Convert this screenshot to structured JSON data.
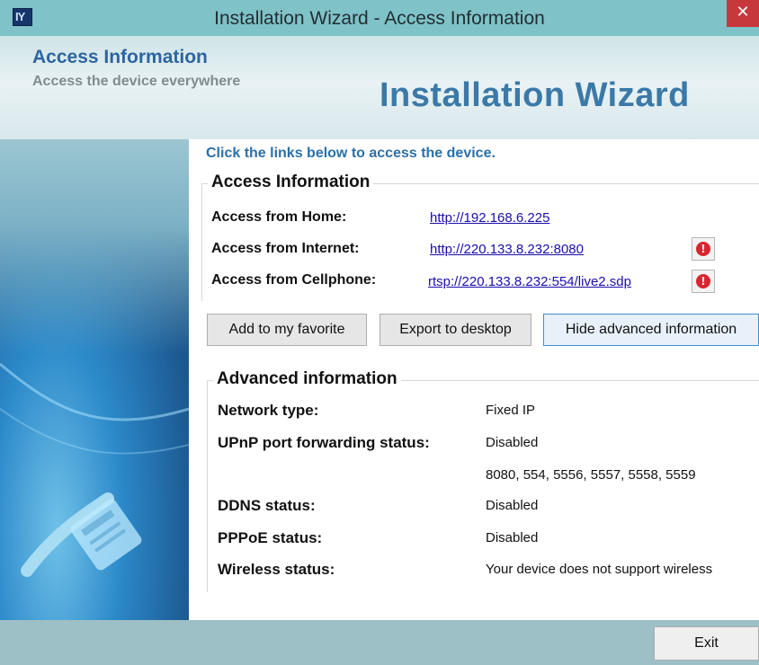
{
  "window": {
    "title": "Installation Wizard - Access Information",
    "close_glyph": "✕",
    "icon_text": "IY"
  },
  "banner": {
    "title": "Access Information",
    "subtitle": "Access the device everywhere",
    "wizard": "Installation Wizard"
  },
  "intro": "Click the links below to access the device.",
  "access": {
    "group_title": "Access Information",
    "rows": [
      {
        "label": "Access from Home:",
        "link": "http://192.168.6.225"
      },
      {
        "label": "Access from Internet:",
        "link": "http://220.133.8.232:8080"
      },
      {
        "label": "Access from Cellphone:",
        "link": "rtsp://220.133.8.232:554/live2.sdp"
      }
    ],
    "warn_glyph": "!"
  },
  "buttons": {
    "favorite": "Add to my favorite",
    "export": "Export to desktop",
    "hide_advanced": "Hide advanced information",
    "exit": "Exit"
  },
  "advanced": {
    "group_title": "Advanced information",
    "rows": [
      {
        "label": "Network type:",
        "value": "Fixed IP"
      },
      {
        "label": "UPnP port forwarding status:",
        "value": "Disabled"
      },
      {
        "label": "",
        "value": "8080, 554, 5556, 5557, 5558, 5559"
      },
      {
        "label": "DDNS status:",
        "value": "Disabled"
      },
      {
        "label": "PPPoE status:",
        "value": "Disabled"
      },
      {
        "label": "Wireless status:",
        "value": "Your device does not support wireless"
      }
    ]
  },
  "colors": {
    "titlebar": "#7fc2c7",
    "close": "#c7383d",
    "accent_blue": "#2b70a8",
    "link": "#1a0dab",
    "warning_red": "#d7262e"
  }
}
